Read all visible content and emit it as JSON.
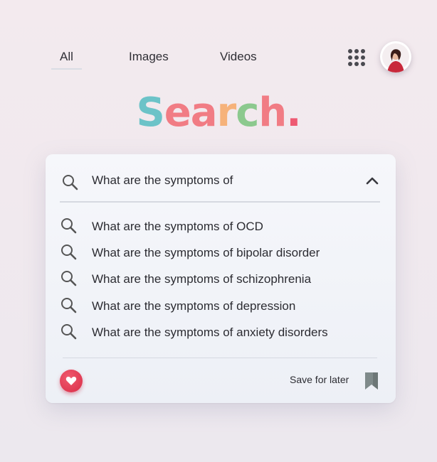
{
  "nav": {
    "tabs": [
      {
        "label": "All",
        "active": true
      },
      {
        "label": "Images",
        "active": false
      },
      {
        "label": "Videos",
        "active": false
      }
    ]
  },
  "logo": {
    "letters": [
      {
        "ch": "S",
        "color": "#6cc3c8"
      },
      {
        "ch": "e",
        "color": "#f17c84"
      },
      {
        "ch": "a",
        "color": "#f17c84"
      },
      {
        "ch": "r",
        "color": "#f6b27a"
      },
      {
        "ch": "c",
        "color": "#8cc98e"
      },
      {
        "ch": "h",
        "color": "#f17c84"
      },
      {
        "ch": ".",
        "color": "#ee5a72"
      }
    ]
  },
  "search": {
    "query": "What are the symptoms of",
    "suggestions": [
      "What are the symptoms of OCD",
      "What are the symptoms of bipolar disorder",
      "What are the symptoms of schizophrenia",
      "What are the symptoms of depression",
      "What are the symptoms of anxiety disorders"
    ]
  },
  "footer": {
    "save_label": "Save for later"
  },
  "icons": {
    "apps": "apps-grid-icon",
    "search": "search-icon",
    "collapse": "chevron-up-icon",
    "favorite": "heart-icon",
    "bookmark": "bookmark-icon"
  },
  "colors": {
    "heart": "#e03a52",
    "bookmark": "#7f8a8a"
  }
}
